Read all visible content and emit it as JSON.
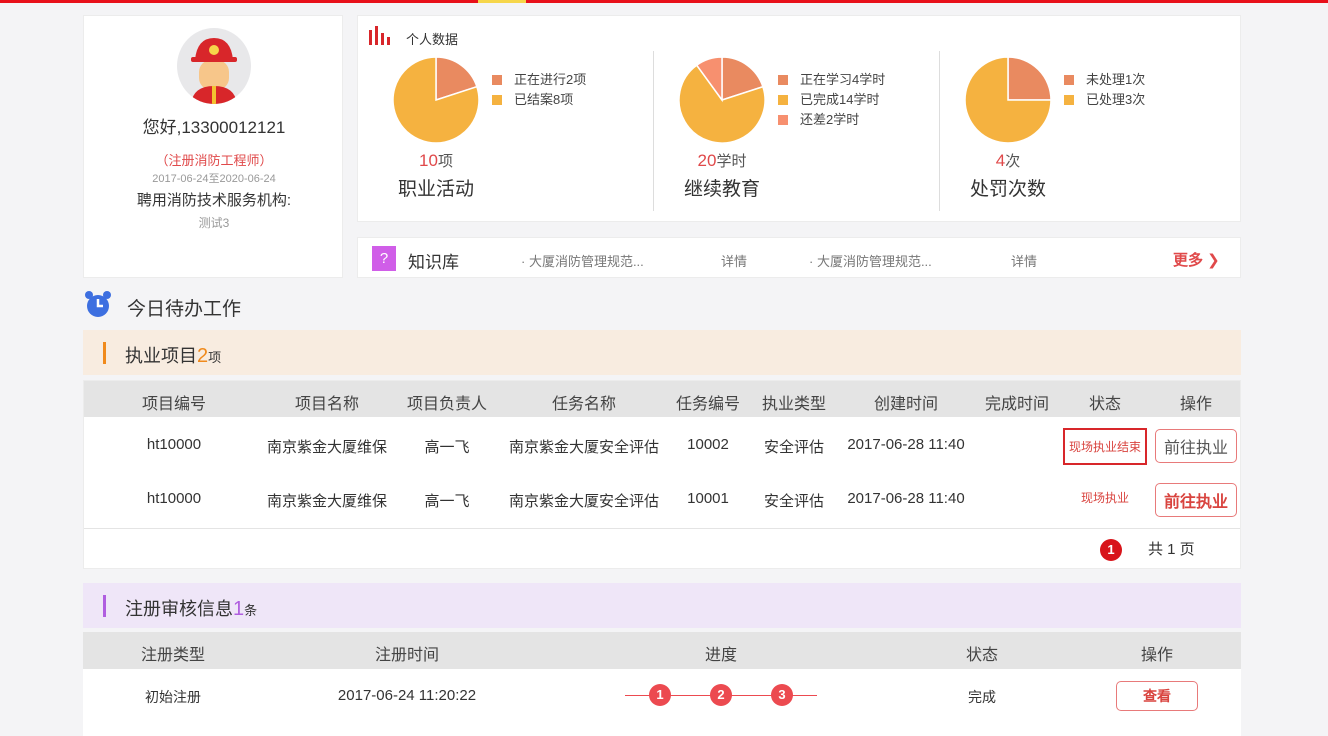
{
  "profile": {
    "greeting": "您好,13300012121",
    "role": "（注册消防工程师）",
    "period": "2017-06-24至2020-06-24",
    "org_label": "聘用消防技术服务机构:",
    "org_name": "测试3"
  },
  "stats": {
    "title": "个人数据",
    "charts": [
      {
        "count": "10",
        "unit": "项",
        "title": "职业活动",
        "slices": [
          {
            "label": "正在进行2项",
            "value": 2,
            "color": "#e98a60"
          },
          {
            "label": "已结案8项",
            "value": 8,
            "color": "#f5b240"
          }
        ]
      },
      {
        "count": "20",
        "unit": "学时",
        "title": "继续教育",
        "slices": [
          {
            "label": "正在学习4学时",
            "value": 4,
            "color": "#e98a60"
          },
          {
            "label": "已完成14学时",
            "value": 14,
            "color": "#f5b240"
          },
          {
            "label": "还差2学时",
            "value": 2,
            "color": "#f7906f"
          }
        ]
      },
      {
        "count": "4",
        "unit": "次",
        "title": "处罚次数",
        "slices": [
          {
            "label": "未处理1次",
            "value": 1,
            "color": "#e98a60"
          },
          {
            "label": "已处理3次",
            "value": 3,
            "color": "#f5b240"
          }
        ]
      }
    ]
  },
  "knowledge": {
    "title": "知识库",
    "items": [
      {
        "text": "· 大厦消防管理规范...",
        "link": "详情"
      },
      {
        "text": "· 大厦消防管理规范...",
        "link": "详情"
      }
    ],
    "more": "更多 ❯"
  },
  "todo": {
    "title": "今日待办工作"
  },
  "projects": {
    "title": "执业项目",
    "count": "2",
    "unit": "项",
    "columns": [
      "项目编号",
      "项目名称",
      "项目负责人",
      "任务名称",
      "任务编号",
      "执业类型",
      "创建时间",
      "完成时间",
      "状态",
      "操作"
    ],
    "rows": [
      [
        "ht10000",
        "南京紫金大厦维保",
        "高一飞",
        "南京紫金大厦安全评估",
        "10002",
        "安全评估",
        "2017-06-28 11:40",
        "",
        "现场执业结束",
        "前往执业"
      ],
      [
        "ht10000",
        "南京紫金大厦维保",
        "高一飞",
        "南京紫金大厦安全评估",
        "10001",
        "安全评估",
        "2017-06-28 11:40",
        "",
        "现场执业",
        "前往执业"
      ]
    ],
    "pagination": {
      "current": "1",
      "total_text": "共 1 页"
    }
  },
  "registration": {
    "title": "注册审核信息",
    "count": "1",
    "unit": "条",
    "columns": [
      "注册类型",
      "注册时间",
      "进度",
      "状态",
      "操作"
    ],
    "rows": [
      {
        "type": "初始注册",
        "time": "2017-06-24 11:20:22",
        "steps": [
          "1",
          "2",
          "3"
        ],
        "status": "完成",
        "action": "查看"
      }
    ]
  }
}
